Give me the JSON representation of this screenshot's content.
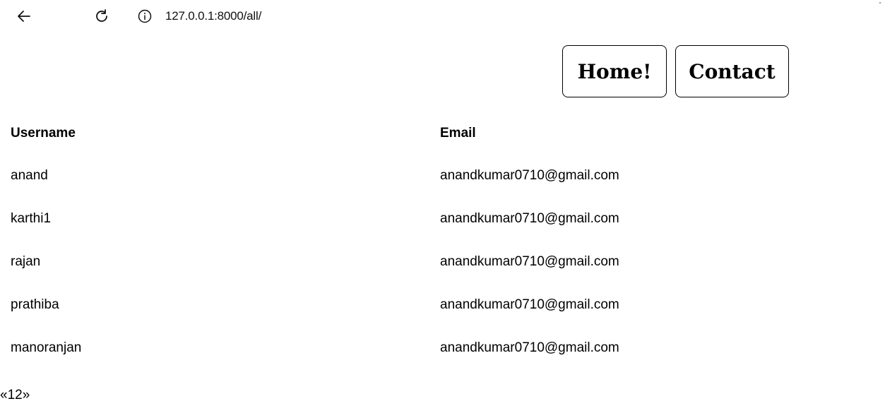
{
  "browser": {
    "url": "127.0.0.1:8000/all/",
    "icons": {
      "back": "arrow-left-icon",
      "reload": "reload-icon",
      "site_info": "info-circle-icon"
    }
  },
  "header": {
    "buttons": [
      {
        "label": "Home!"
      },
      {
        "label": "Contact"
      }
    ]
  },
  "table": {
    "columns": [
      "Username",
      "Email"
    ],
    "rows": [
      {
        "username": "anand",
        "email": "anandkumar0710@gmail.com"
      },
      {
        "username": "karthi1",
        "email": "anandkumar0710@gmail.com"
      },
      {
        "username": "rajan",
        "email": "anandkumar0710@gmail.com"
      },
      {
        "username": "prathiba",
        "email": "anandkumar0710@gmail.com"
      },
      {
        "username": "manoranjan",
        "email": "anandkumar0710@gmail.com"
      }
    ]
  },
  "pagination": {
    "prev": "«",
    "pages": [
      "1",
      "2"
    ],
    "next": "»"
  }
}
